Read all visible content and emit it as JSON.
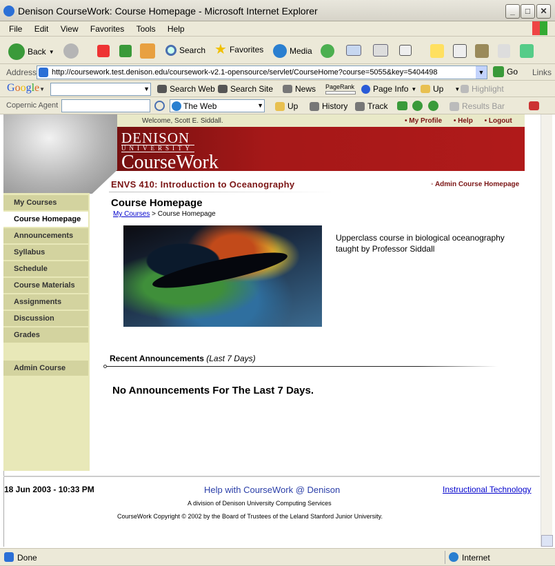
{
  "window": {
    "title": "Denison CourseWork: Course Homepage - Microsoft Internet Explorer"
  },
  "menubar": [
    "File",
    "Edit",
    "View",
    "Favorites",
    "Tools",
    "Help"
  ],
  "toolbar": {
    "back": "Back",
    "search": "Search",
    "favorites": "Favorites",
    "media": "Media"
  },
  "address": {
    "label": "Address",
    "url": "http://coursework.test.denison.edu/coursework-v2.1-opensource/servlet/CourseHome?course=5055&key=5404498",
    "go": "Go",
    "links": "Links"
  },
  "google": {
    "search_web": "Search Web",
    "search_site": "Search Site",
    "news": "News",
    "pagerank": "PageRank",
    "page_info": "Page Info",
    "up": "Up",
    "highlight": "Highlight"
  },
  "copernic": {
    "label": "Copernic Agent",
    "scope": "The Web",
    "up": "Up",
    "history": "History",
    "track": "Track",
    "results_bar": "Results Bar"
  },
  "site": {
    "welcome": "Welcome, Scott E. Siddall.",
    "top_links": [
      "My Profile",
      "Help",
      "Logout"
    ],
    "logo_line1": "DENISON",
    "logo_line2": "UNIVERSITY",
    "logo_line3": "CourseWork",
    "course_title": "ENVS 410: Introduction to Oceanography",
    "admin_link": "Admin Course Homepage",
    "page_heading": "Course Homepage",
    "breadcrumb_link": "My Courses",
    "breadcrumb_sep": ">",
    "breadcrumb_current": "Course Homepage",
    "description": "Upperclass course in biological oceanography taught by Professor Siddall",
    "announcements_heading": "Recent Announcements",
    "announcements_period": "(Last 7 Days)",
    "no_announcements": "No Announcements For The Last 7 Days."
  },
  "nav": [
    "My Courses",
    "Course Homepage",
    "Announcements",
    "Syllabus",
    "Schedule",
    "Course Materials",
    "Assignments",
    "Discussion",
    "Grades"
  ],
  "nav_admin": "Admin Course",
  "footer": {
    "datetime": "18 Jun 2003 - 10:33 PM",
    "help": "Help with CourseWork @ Denison",
    "instructional": "Instructional Technology",
    "division": "A division of Denison University Computing Services",
    "copyright": "CourseWork Copyright © 2002 by the Board of Trustees of the Leland Stanford Junior University."
  },
  "status": {
    "text": "Done",
    "zone": "Internet"
  }
}
